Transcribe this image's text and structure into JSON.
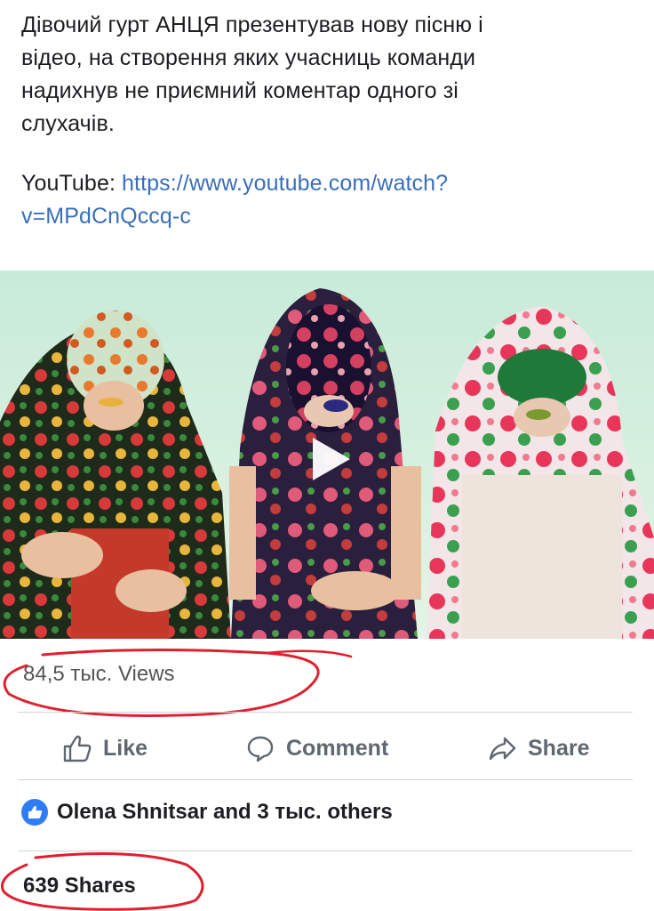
{
  "post": {
    "text_lines": [
      "Дівочий гурт АНЦЯ презентував нову пісню і",
      "відео, на створення яких учасниць команди",
      "надихнув не приємний коментар одного зі",
      "слухачів."
    ],
    "link_label": "YouTube: ",
    "link_url_line1": "https://www.youtube.com/watch?",
    "link_url_line2": "v=MPdCnQccq-c"
  },
  "video": {
    "play_icon": "play-icon"
  },
  "stats": {
    "views": "84,5 тыс. Views",
    "reactions_text": "Olena Shnitsar and 3 тыс. others",
    "shares": "639 Shares"
  },
  "actions": {
    "like": "Like",
    "comment": "Comment",
    "share": "Share"
  },
  "colors": {
    "link": "#3a6fb9",
    "annotation": "#e0202e",
    "like_badge": "#2f7df6"
  }
}
